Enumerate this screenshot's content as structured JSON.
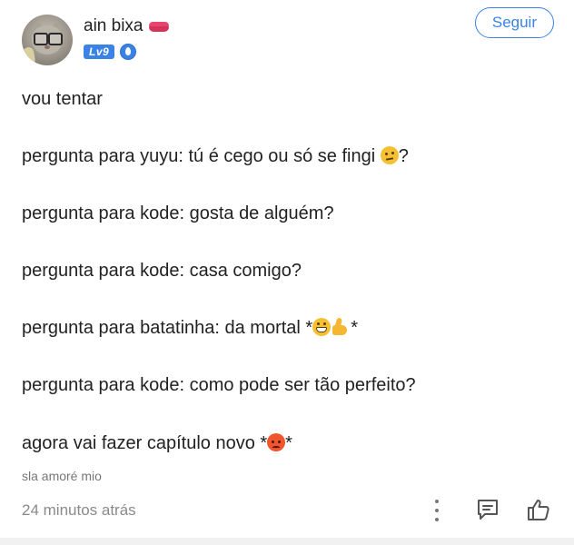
{
  "post": {
    "author": {
      "name": "ain bixa",
      "level_badge": "Lv9"
    },
    "follow_label": "Seguir",
    "lines": [
      {
        "text": "vou tentar"
      },
      {
        "text": "pergunta para yuyu: tú é cego ou só se fingi ",
        "emoji": "thinking-face",
        "suffix": "?"
      },
      {
        "text": "pergunta para kode: gosta de alguém?"
      },
      {
        "text": "pergunta para kode: casa comigo?"
      },
      {
        "text": "pergunta para batatinha: da mortal *",
        "emoji": "grinning-face+thumbs-up",
        "suffix": "*"
      },
      {
        "text": "pergunta para kode: como pode ser tão perfeito?"
      },
      {
        "text": "agora vai fazer capítulo novo *",
        "emoji": "angry-face",
        "suffix": "*"
      }
    ],
    "caption": "sla amoré mio",
    "timestamp": "24 minutos atrás"
  },
  "colors": {
    "accent": "#3b82e6",
    "text": "#222222",
    "muted": "#8a8a8a"
  },
  "icons": {
    "name_decoration": "lips-icon",
    "verified": "shield-icon",
    "more": "more-vertical-icon",
    "comment": "comment-icon",
    "like": "thumbs-up-icon"
  }
}
